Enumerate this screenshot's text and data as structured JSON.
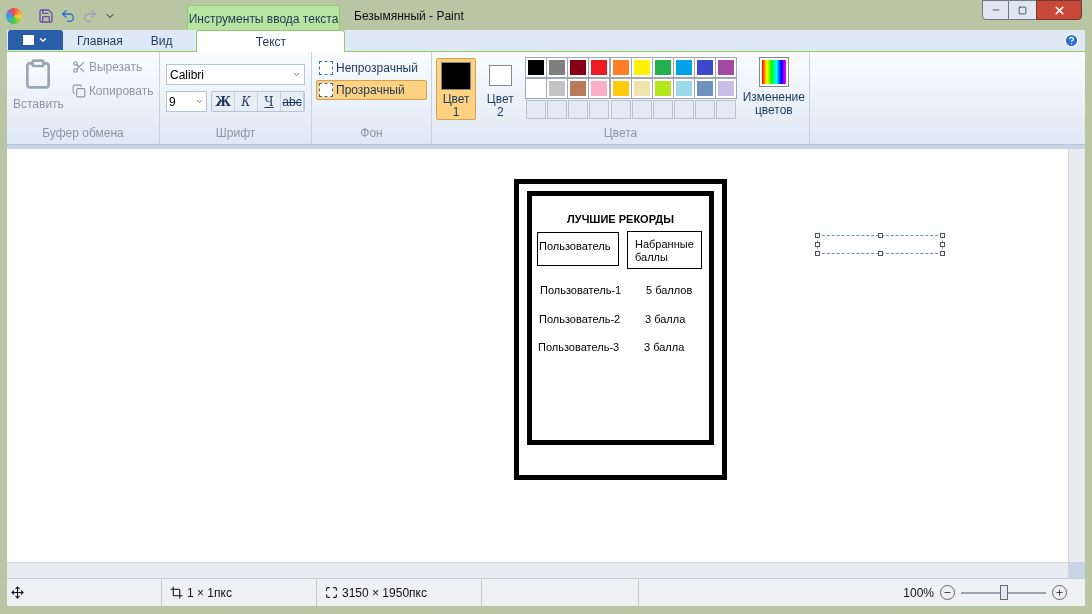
{
  "window": {
    "title": "Безымянный - Paint",
    "contextual_tab": "Инструменты ввода текста"
  },
  "tabs": [
    {
      "label": "Главная",
      "selected": false
    },
    {
      "label": "Вид",
      "selected": false
    },
    {
      "label": "Текст",
      "selected": true
    }
  ],
  "clipboard": {
    "group": "Буфер обмена",
    "paste": "Вставить",
    "cut": "Вырезать",
    "copy": "Копировать"
  },
  "font": {
    "group": "Шрифт",
    "family": "Calibri",
    "size": "9",
    "styles": [
      {
        "kind": "bold",
        "label": "Ж"
      },
      {
        "kind": "italic",
        "label": "К"
      },
      {
        "kind": "underline",
        "label": "Ч"
      },
      {
        "kind": "strike",
        "label": "abc"
      }
    ]
  },
  "background": {
    "group": "Фон",
    "options": [
      {
        "label": "Непрозрачный",
        "selected": false
      },
      {
        "label": "Прозрачный",
        "selected": true
      }
    ]
  },
  "colors": {
    "group": "Цвета",
    "slots": [
      {
        "label": "Цвет",
        "number": "1",
        "color": "#000000",
        "selected": true
      },
      {
        "label": "Цвет",
        "number": "2",
        "color": "#ffffff",
        "selected": false
      }
    ],
    "palette": [
      {
        "color": "#000000"
      },
      {
        "color": "#7f7f7f"
      },
      {
        "color": "#880015"
      },
      {
        "color": "#ed1c24"
      },
      {
        "color": "#ff7f27"
      },
      {
        "color": "#fff200"
      },
      {
        "color": "#22b14c"
      },
      {
        "color": "#00a2e8"
      },
      {
        "color": "#3f48cc"
      },
      {
        "color": "#a349a4"
      },
      {
        "color": "#ffffff"
      },
      {
        "color": "#c3c3c3"
      },
      {
        "color": "#b97a57"
      },
      {
        "color": "#ffaec9"
      },
      {
        "color": "#ffc90e"
      },
      {
        "color": "#efe4b0"
      },
      {
        "color": "#b5e61d"
      },
      {
        "color": "#99d9ea"
      },
      {
        "color": "#7092be"
      },
      {
        "color": "#c8bfe7"
      }
    ],
    "edit": "Изменение цветов"
  },
  "canvas": {
    "title": "ЛУЧШИЕ РЕКОРДЫ",
    "headers": [
      "Пользователь",
      "Набранные баллы"
    ],
    "rows": [
      {
        "user": "Пользователь-1",
        "score": "5 баллов"
      },
      {
        "user": "Пользователь-2",
        "score": "3 балла"
      },
      {
        "user": "Пользователь-3",
        "score": "3 балла"
      }
    ]
  },
  "status_bar": {
    "selection_size": "1 × 1пкс",
    "image_size": "3150 × 1950пкс",
    "zoom": "100%",
    "level": 0.5
  }
}
